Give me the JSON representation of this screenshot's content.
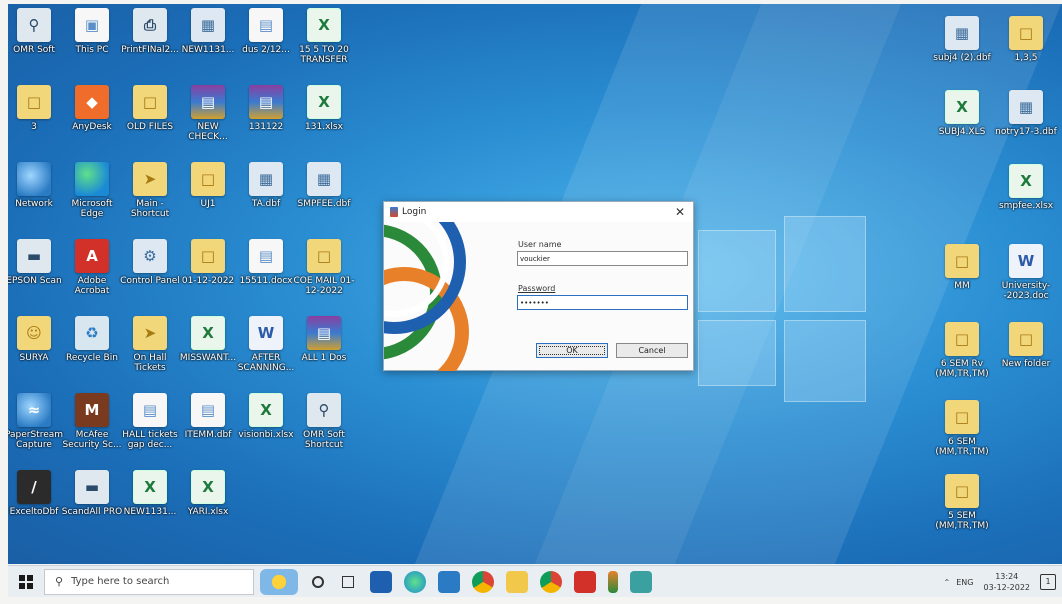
{
  "desktop_icons": [
    {
      "label": "OMR Soft",
      "icon": "magnifier-icon"
    },
    {
      "label": "This PC",
      "icon": "computer-icon"
    },
    {
      "label": "PrintFINal2...",
      "icon": "printer-icon"
    },
    {
      "label": "NEW1131...",
      "icon": "dbf-file-icon"
    },
    {
      "label": "dus 2/12...",
      "icon": "document-icon"
    },
    {
      "label": "15 5 TO 20 TRANSFER",
      "icon": "excel-file-icon"
    },
    {
      "label": "3",
      "icon": "folder-icon"
    },
    {
      "label": "AnyDesk",
      "icon": "anydesk-icon"
    },
    {
      "label": "OLD FILES",
      "icon": "folder-icon"
    },
    {
      "label": "NEW CHECK...",
      "icon": "rar-archive-icon"
    },
    {
      "label": "131122",
      "icon": "rar-archive-icon"
    },
    {
      "label": "131.xlsx",
      "icon": "excel-file-icon"
    },
    {
      "label": "Network",
      "icon": "network-icon"
    },
    {
      "label": "Microsoft Edge",
      "icon": "edge-icon"
    },
    {
      "label": "Main - Shortcut",
      "icon": "shortcut-icon"
    },
    {
      "label": "UJ1",
      "icon": "folder-icon"
    },
    {
      "label": "TA.dbf",
      "icon": "dbf-file-icon"
    },
    {
      "label": "SMPFEE.dbf",
      "icon": "dbf-file-icon"
    },
    {
      "label": "EPSON Scan",
      "icon": "scanner-icon"
    },
    {
      "label": "Adobe Acrobat",
      "icon": "acrobat-icon"
    },
    {
      "label": "Control Panel",
      "icon": "control-panel-icon"
    },
    {
      "label": "01-12-2022",
      "icon": "folder-icon"
    },
    {
      "label": "15511.docx",
      "icon": "document-icon"
    },
    {
      "label": "COE MAIL 01-12-2022",
      "icon": "folder-icon"
    },
    {
      "label": "SURYA",
      "icon": "user-folder-icon"
    },
    {
      "label": "Recycle Bin",
      "icon": "recycle-bin-icon"
    },
    {
      "label": "On Hall Tickets",
      "icon": "shortcut-icon"
    },
    {
      "label": "MISSWANT...",
      "icon": "excel-file-icon"
    },
    {
      "label": "AFTER SCANNING...",
      "icon": "word-file-icon"
    },
    {
      "label": "ALL 1 Dos",
      "icon": "rar-archive-icon"
    },
    {
      "label": "PaperStream Capture",
      "icon": "paperstream-icon"
    },
    {
      "label": "McAfee Security Sc...",
      "icon": "mcafee-icon"
    },
    {
      "label": "HALL tickets gap dec...",
      "icon": "document-icon"
    },
    {
      "label": "ITEMM.dbf",
      "icon": "document-icon"
    },
    {
      "label": "visionbi.xlsx",
      "icon": "excel-file-icon"
    },
    {
      "label": "OMR Soft Shortcut",
      "icon": "magnifier-icon"
    },
    {
      "label": "ExceltoDbf",
      "icon": "excel-to-dbf-icon"
    },
    {
      "label": "ScandAll PRO",
      "icon": "scanner-icon"
    },
    {
      "label": "NEW1131...",
      "icon": "excel-file-icon"
    },
    {
      "label": "YARI.xlsx",
      "icon": "excel-file-icon"
    }
  ],
  "right_icons": [
    {
      "label": "subj4 (2).dbf",
      "icon": "dbf-file-icon"
    },
    {
      "label": "1,3,5",
      "icon": "folder-icon"
    },
    {
      "label": "SUBJ4.XLS",
      "icon": "excel-file-icon"
    },
    {
      "label": "notry17-3.dbf",
      "icon": "dbf-file-icon"
    },
    {
      "label": "smpfee.xlsx",
      "icon": "excel-file-icon"
    },
    {
      "label": "MM",
      "icon": "folder-icon"
    },
    {
      "label": "University--2023.doc",
      "icon": "word-file-icon"
    },
    {
      "label": "6 SEM Rv (MM,TR,TM)",
      "icon": "folder-icon"
    },
    {
      "label": "New folder",
      "icon": "folder-icon"
    },
    {
      "label": "6 SEM (MM,TR,TM)",
      "icon": "folder-icon"
    },
    {
      "label": "5 SEM (MM,TR,TM)",
      "icon": "folder-icon"
    }
  ],
  "login": {
    "title": "Login",
    "username_label": "User name",
    "username_value": "vouckier",
    "password_label": "Password",
    "password_value": "•••••••",
    "ok_label": "OK",
    "cancel_label": "Cancel",
    "close_glyph": "✕"
  },
  "taskbar": {
    "search_placeholder": "Type here to search",
    "tray_language": "ENG",
    "time": "13:24",
    "date": "03-12-2022",
    "notification_count": "1"
  }
}
